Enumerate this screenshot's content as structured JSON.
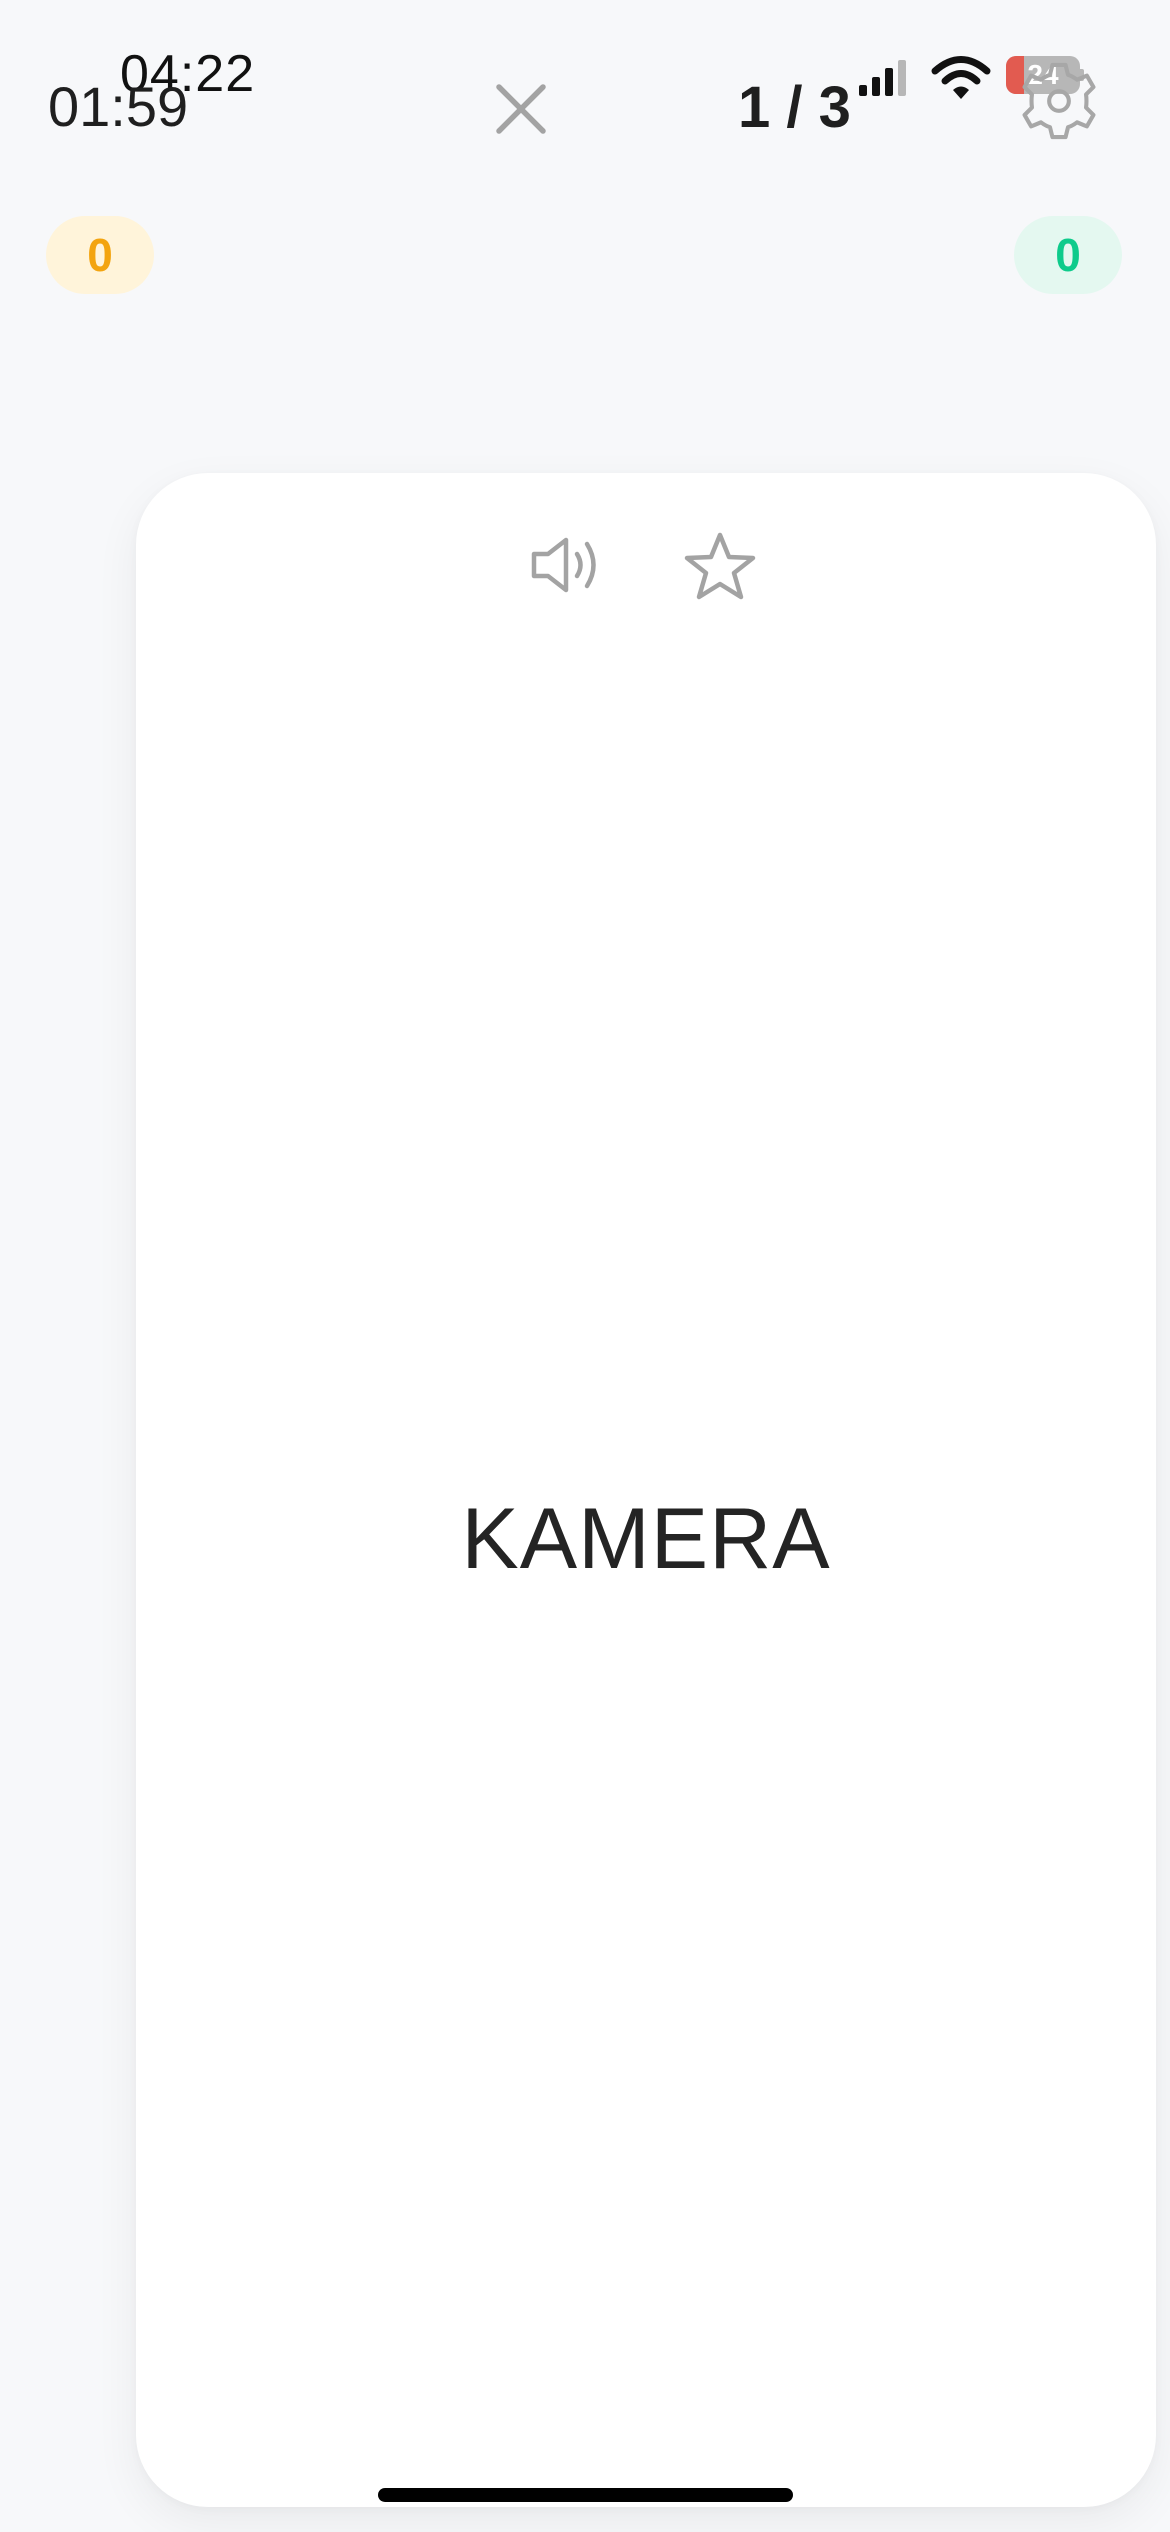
{
  "status_bar": {
    "time": "04:22",
    "battery_percent": "24",
    "battery_level": 0.24,
    "battery_fill_color": "#e25b50",
    "signal_icon": "signal-icon",
    "wifi_icon": "wifi-icon"
  },
  "header": {
    "timer": "01:59",
    "close_icon": "close-icon",
    "progress": "1 / 3",
    "settings_icon": "gear-icon"
  },
  "scores": {
    "left": "0",
    "right": "0",
    "left_color": "#f3a40f",
    "right_color": "#0ecb8b"
  },
  "card": {
    "word": "KAMERA",
    "audio_icon": "speaker-icon",
    "favorite_icon": "star-icon"
  }
}
